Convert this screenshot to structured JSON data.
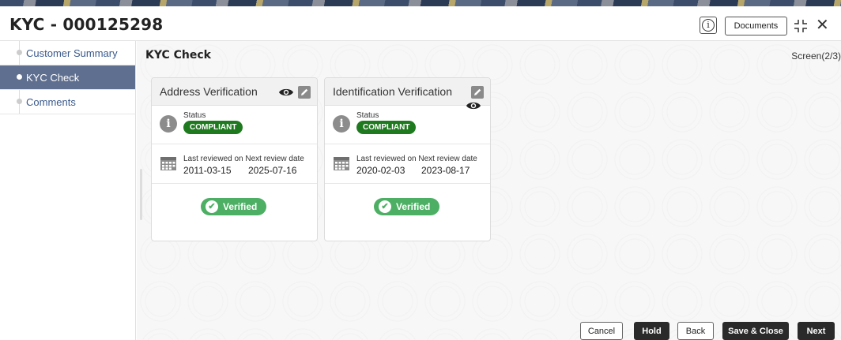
{
  "header": {
    "title": "KYC - 000125298",
    "info_glyph": "i",
    "documents_label": "Documents",
    "close_glyph": "✕"
  },
  "sidebar": {
    "items": [
      {
        "label": "Customer Summary",
        "active": false
      },
      {
        "label": "KYC Check",
        "active": true
      },
      {
        "label": "Comments",
        "active": false
      }
    ]
  },
  "main": {
    "title": "KYC Check",
    "screen_indicator": "Screen(2/3)"
  },
  "cards": [
    {
      "title": "Address Verification",
      "status_label": "Status",
      "status": "COMPLIANT",
      "review_label": "Last reviewed on Next review date",
      "last_reviewed": "2011-03-15",
      "next_review": "2025-07-16",
      "verified_label": "Verified"
    },
    {
      "title": "Identification Verification",
      "status_label": "Status",
      "status": "COMPLIANT",
      "review_label": "Last reviewed on Next review date",
      "last_reviewed": "2020-02-03",
      "next_review": "2023-08-17",
      "verified_label": "Verified"
    }
  ],
  "footer": {
    "cancel": "Cancel",
    "hold": "Hold",
    "back": "Back",
    "save_close": "Save & Close",
    "next": "Next"
  },
  "colors": {
    "sidebar_active": "#5f6f8f",
    "compliant_badge": "#1f7a1f",
    "verified_badge": "#4caf64",
    "dark_button": "#2a2a2a"
  },
  "icons": [
    "info-icon",
    "expand-icon",
    "close-icon",
    "eye-icon",
    "edit-icon",
    "info-circle-icon",
    "calendar-icon",
    "check-circle-icon"
  ]
}
